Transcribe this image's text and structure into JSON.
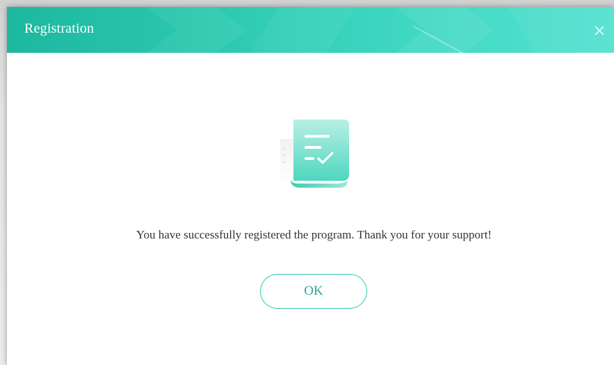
{
  "window": {
    "title": "Registration",
    "close_icon": "close-icon"
  },
  "main": {
    "illustration_icon": "registration-receipt-icon",
    "message": "You have successfully registered the program. Thank you for your support!",
    "ok_label": "OK"
  },
  "colors": {
    "accent": "#2ec5ab",
    "titlebar_start": "#1cb89f",
    "titlebar_end": "#55e1d1",
    "ok_text": "#2aa890",
    "message_text": "#333333"
  }
}
